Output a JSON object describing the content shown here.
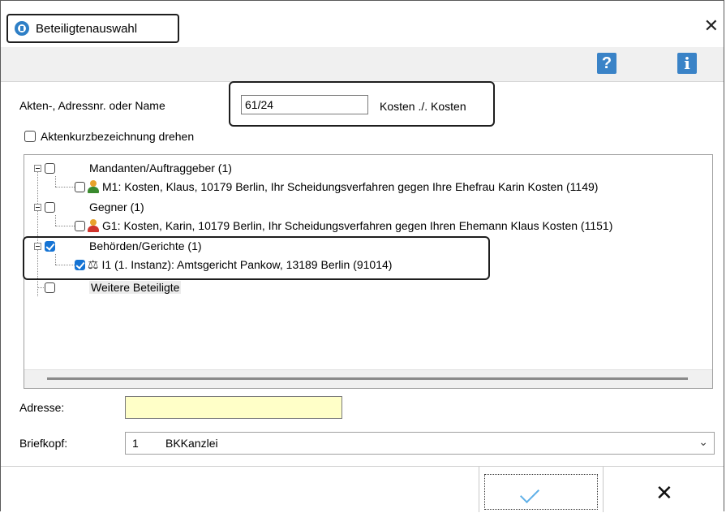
{
  "window": {
    "title": "Beteiligtenauswahl",
    "close_glyph": "✕"
  },
  "toolbar": {
    "help_glyph": "?",
    "info_glyph": "i"
  },
  "search": {
    "label": "Akten-, Adressnr. oder Name",
    "value": "61/24",
    "result": "Kosten ./. Kosten"
  },
  "turn_checkbox": {
    "label": "Aktenkurzbezeichnung drehen",
    "checked": false
  },
  "tree": {
    "groups": [
      {
        "label": "Mandanten/Auftraggeber (1)",
        "checked": false,
        "items": [
          {
            "label": "M1: Kosten, Klaus, 10179 Berlin, Ihr Scheidungsverfahren gegen Ihre Ehefrau Karin Kosten (1149)",
            "icon": "person-green-icon",
            "checked": false
          }
        ]
      },
      {
        "label": "Gegner (1)",
        "checked": false,
        "items": [
          {
            "label": "G1: Kosten, Karin, 10179 Berlin, Ihr Scheidungsverfahren gegen Ihren Ehemann Klaus Kosten (1151)",
            "icon": "person-red-icon",
            "checked": false
          }
        ]
      },
      {
        "label": "Behörden/Gerichte (1)",
        "checked": true,
        "items": [
          {
            "label": "I1 (1. Instanz): Amtsgericht Pankow, 13189 Berlin (91014)",
            "icon": "scale-icon",
            "checked": true
          }
        ]
      },
      {
        "label": "Weitere Beteiligte",
        "checked": false,
        "items": []
      }
    ]
  },
  "address": {
    "label": "Adresse:",
    "value": ""
  },
  "letterhead": {
    "label": "Briefkopf:",
    "number": "1",
    "name": "BKKanzlei"
  },
  "buttons": {
    "ok_glyph": "✓",
    "cancel_glyph": "✕"
  },
  "colors": {
    "accent": "#1473d4",
    "address_bg": "#ffffc8",
    "help_icon": "#3a83c7"
  }
}
